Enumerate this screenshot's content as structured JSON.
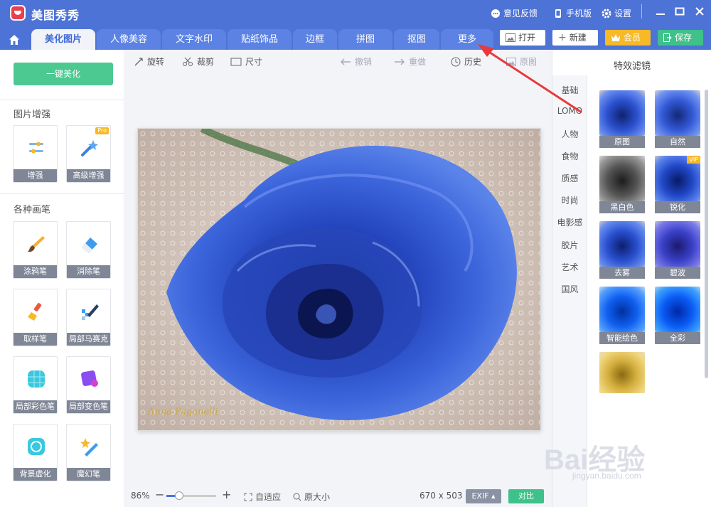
{
  "app": {
    "title": "美图秀秀"
  },
  "titlebar": {
    "feedback": "意见反馈",
    "mobile": "手机版",
    "settings": "设置"
  },
  "tabs": [
    "美化图片",
    "人像美容",
    "文字水印",
    "贴纸饰品",
    "边框",
    "拼图",
    "抠图",
    "更多"
  ],
  "actions": {
    "open": "打开",
    "new": "新建",
    "vip": "会员",
    "save": "保存"
  },
  "left": {
    "onekey": "一键美化",
    "section1": "图片增强",
    "section2": "各种画笔",
    "tools": [
      "增强",
      "高级增强",
      "涂鸦笔",
      "消除笔",
      "取样笔",
      "局部马赛克",
      "局部彩色笔",
      "局部变色笔",
      "背景虚化",
      "魔幻笔"
    ],
    "pro_badge": "Pro"
  },
  "toolbar": {
    "rotate": "旋转",
    "crop": "裁剪",
    "size": "尺寸",
    "undo": "撤销",
    "redo": "重做",
    "history": "历史",
    "original": "原图"
  },
  "photo": {
    "signature": "Anna Paganelli"
  },
  "status": {
    "zoom": "86%",
    "zoom_fraction": 0.25,
    "fit": "自适应",
    "actual": "原大小",
    "dimensions": "670 x 503",
    "exif": "EXIF",
    "compare": "对比"
  },
  "right": {
    "title": "特效滤镜",
    "categories": [
      "基础",
      "LOMO",
      "人物",
      "食物",
      "质感",
      "时尚",
      "电影感",
      "胶片",
      "艺术",
      "国风"
    ],
    "filters": [
      "原图",
      "自然",
      "黑白色",
      "锐化",
      "去雾",
      "碧波",
      "智能绘色",
      "全彩"
    ],
    "vip_badge": "VIP"
  },
  "watermark": {
    "brand": "Bai经验",
    "url": "jingyan.baidu.com"
  },
  "colors": {
    "primary": "#4e73d6",
    "green": "#4cc991",
    "vip": "#f6b928",
    "rose": "#2a4fc0"
  }
}
